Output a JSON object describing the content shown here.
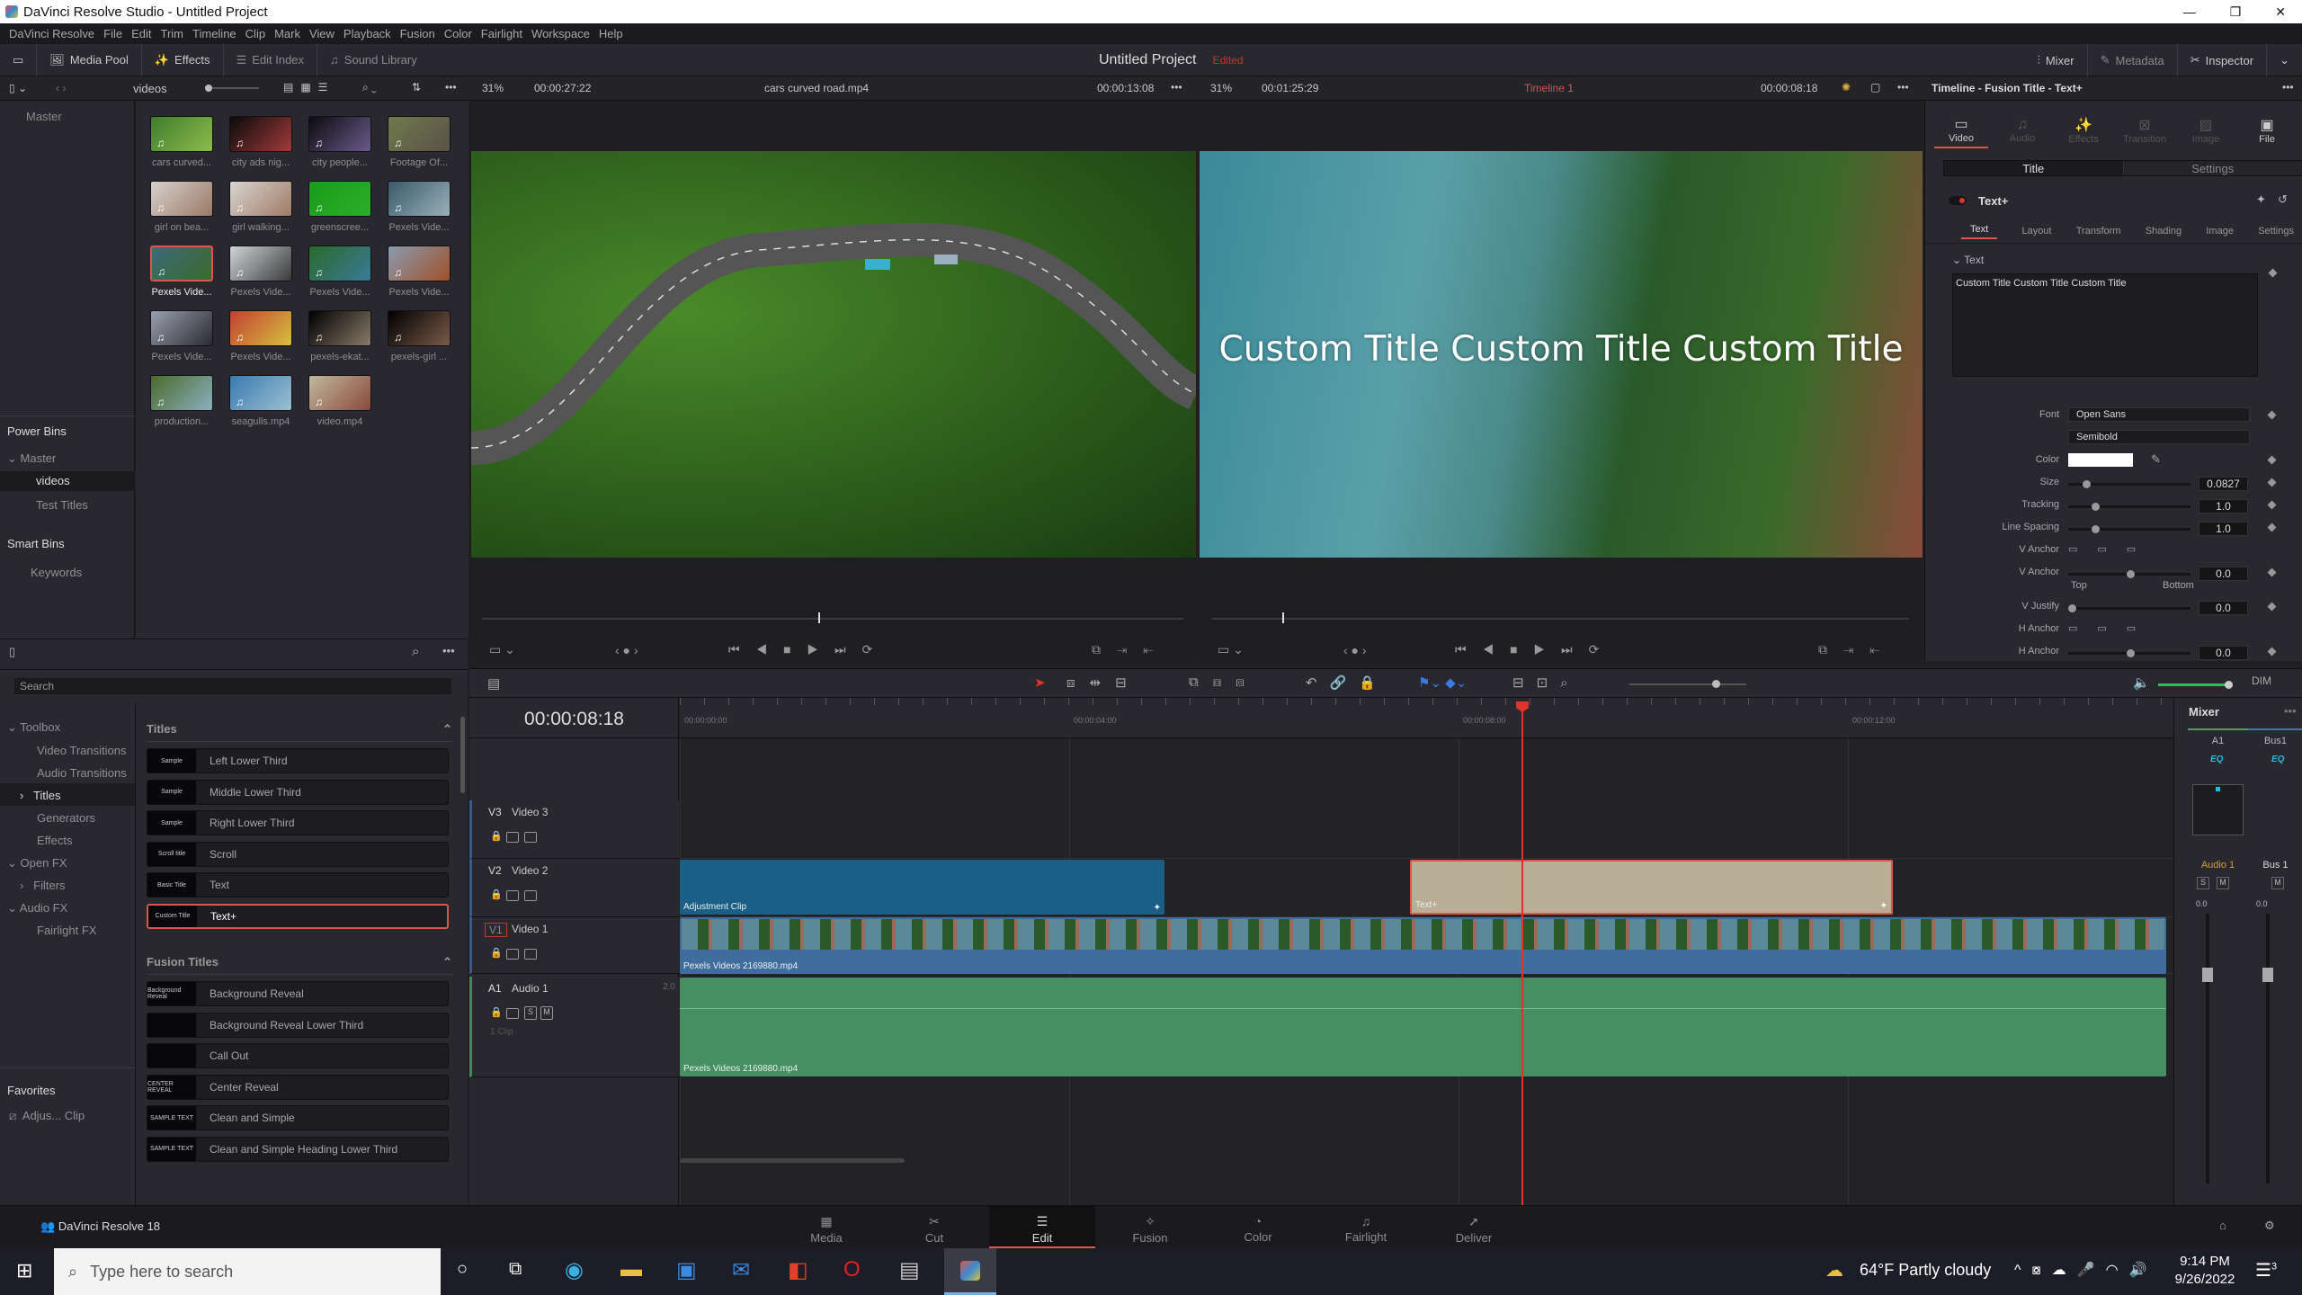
{
  "window": {
    "title": "DaVinci Resolve Studio - Untitled Project",
    "controls": [
      "—",
      "❐",
      "✕"
    ]
  },
  "menu": [
    "DaVinci Resolve",
    "File",
    "Edit",
    "Trim",
    "Timeline",
    "Clip",
    "Mark",
    "View",
    "Playback",
    "Fusion",
    "Color",
    "Fairlight",
    "Workspace",
    "Help"
  ],
  "toolbar": {
    "media_pool": "Media Pool",
    "effects": "Effects",
    "edit_index": "Edit Index",
    "sound_library": "Sound Library",
    "project_title": "Untitled Project",
    "project_status": "Edited",
    "mixer": "Mixer",
    "metadata": "Metadata",
    "inspector": "Inspector"
  },
  "source_bar": {
    "bin": "videos",
    "zoom": "31%",
    "duration": "00:00:27:22",
    "clip": "cars curved road.mp4",
    "timecode": "00:00:13:08"
  },
  "program_bar": {
    "zoom": "31%",
    "duration": "00:01:25:29",
    "timeline": "Timeline 1",
    "timecode": "00:00:08:18"
  },
  "bins": {
    "master": "Master",
    "power_bins": "Power Bins",
    "power_master": "Master",
    "items": [
      "videos",
      "Test Titles"
    ],
    "smart_bins": "Smart Bins",
    "keywords": "Keywords"
  },
  "media": [
    {
      "label": "cars curved...",
      "c1": "#3f7d2c",
      "c2": "#8dbb4c"
    },
    {
      "label": "city ads nig...",
      "c1": "#0a0a0a",
      "c2": "#a23a3a"
    },
    {
      "label": "city people...",
      "c1": "#0c0c10",
      "c2": "#6a5a8a"
    },
    {
      "label": "Footage Of...",
      "c1": "#6f7a4a",
      "c2": "#5a514a"
    },
    {
      "label": "girl on bea...",
      "c1": "#d8d0cc",
      "c2": "#9a7a66"
    },
    {
      "label": "girl walking...",
      "c1": "#d8d4d0",
      "c2": "#a07a66"
    },
    {
      "label": "greenscree...",
      "c1": "#1a9a1a",
      "c2": "#2bb02b"
    },
    {
      "label": "Pexels Vide...",
      "c1": "#3a5a6a",
      "c2": "#9ab0b8"
    },
    {
      "label": "Pexels Vide...",
      "c1": "#3a6a7a",
      "c2": "#3d6a2a",
      "selected": true
    },
    {
      "label": "Pexels Vide...",
      "c1": "#d0d4d8",
      "c2": "#3a3a3a"
    },
    {
      "label": "Pexels Vide...",
      "c1": "#2a6a2a",
      "c2": "#3a7a9a"
    },
    {
      "label": "Pexels Vide...",
      "c1": "#8a9ab0",
      "c2": "#a0502a"
    },
    {
      "label": "Pexels Vide...",
      "c1": "#9aa0b0",
      "c2": "#2a2a30"
    },
    {
      "label": "Pexels Vide...",
      "c1": "#c04030",
      "c2": "#d8c040"
    },
    {
      "label": "pexels-ekat...",
      "c1": "#000000",
      "c2": "#8a7a6a"
    },
    {
      "label": "pexels-girl ...",
      "c1": "#000000",
      "c2": "#7a5a4a"
    },
    {
      "label": "production...",
      "c1": "#4a6a2a",
      "c2": "#8ab0c0"
    },
    {
      "label": "seagulls.mp4",
      "c1": "#3a7ab0",
      "c2": "#9ac0d0"
    },
    {
      "label": "video.mp4",
      "c1": "#c0b8a0",
      "c2": "#8a4a3a"
    }
  ],
  "viewer": {
    "title_overlay": "Custom Title Custom Title Custom Title",
    "source_progress": 0.48,
    "program_progress": 0.1
  },
  "effects": {
    "toolbox": "Toolbox",
    "tree": [
      "Video Transitions",
      "Audio Transitions",
      "Titles",
      "Generators",
      "Effects"
    ],
    "open_fx": "Open FX",
    "filters": "Filters",
    "audio_fx": "Audio FX",
    "fairlight_fx": "Fairlight FX",
    "search": "Search",
    "favorites": "Favorites",
    "favorite_item": "Adjus... Clip",
    "titles_header": "Titles",
    "titles": [
      {
        "preview": "Sample",
        "name": "Left Lower Third"
      },
      {
        "preview": "Sample",
        "name": "Middle Lower Third"
      },
      {
        "preview": "Sample",
        "name": "Right Lower Third"
      },
      {
        "preview": "Scroll title",
        "name": "Scroll"
      },
      {
        "preview": "Basic Title",
        "name": "Text"
      },
      {
        "preview": "Custom Title",
        "name": "Text+",
        "selected": true
      }
    ],
    "fusion_header": "Fusion Titles",
    "fusion": [
      {
        "preview": "Background Reveal",
        "name": "Background Reveal"
      },
      {
        "preview": "",
        "name": "Background Reveal Lower Third"
      },
      {
        "preview": "",
        "name": "Call Out"
      },
      {
        "preview": "CENTER REVEAL",
        "name": "Center Reveal"
      },
      {
        "preview": "SAMPLE TEXT",
        "name": "Clean and Simple"
      },
      {
        "preview": "SAMPLE TEXT",
        "name": "Clean and Simple Heading Lower Third"
      }
    ]
  },
  "inspector": {
    "header": "Timeline - Fusion Title - Text+",
    "tabs": [
      "Video",
      "Audio",
      "Effects",
      "Transition",
      "Image",
      "File"
    ],
    "sub_tabs": [
      "Title",
      "Settings"
    ],
    "node": "Text+",
    "node_tabs": [
      "Text",
      "Layout",
      "Transform",
      "Shading",
      "Image",
      "Settings"
    ],
    "section": "Text",
    "text_value": "Custom Title Custom Title Custom Title",
    "font_label": "Font",
    "font": "Open Sans",
    "style": "Semibold",
    "color_label": "Color",
    "color": "#ffffff",
    "params": [
      {
        "label": "Size",
        "value": "0.0827",
        "pos": 0.12
      },
      {
        "label": "Tracking",
        "value": "1.0",
        "pos": 0.2
      },
      {
        "label": "Line Spacing",
        "value": "1.0",
        "pos": 0.2
      }
    ],
    "v_anchor_label": "V Anchor",
    "v_anchor": {
      "label": "V Anchor",
      "value": "0.0",
      "pos": 0.5,
      "left": "Top",
      "right": "Bottom"
    },
    "v_justify": {
      "label": "V Justify",
      "value": "0.0",
      "pos": 0.0
    },
    "h_anchor_label": "H Anchor",
    "h_anchor": {
      "label": "H Anchor",
      "value": "0.0",
      "pos": 0.5
    }
  },
  "timeline": {
    "timecode": "00:00:08:18",
    "ruler": [
      "00:00:00:00",
      "00:00:04:00",
      "00:00:08:00",
      "00:00:12:00"
    ],
    "tracks": [
      {
        "id": "V3",
        "name": "Video 3"
      },
      {
        "id": "V2",
        "name": "Video 2"
      },
      {
        "id": "V1",
        "name": "Video 1"
      }
    ],
    "audio": {
      "id": "A1",
      "name": "Audio 1",
      "channels": "2.0",
      "clips": "1 Clip",
      "solo": "S",
      "mute": "M"
    },
    "clips": {
      "adjustment": "Adjustment Clip",
      "title": "Text+",
      "video": "Pexels Videos 2169880.mp4",
      "audio": "Pexels Videos 2169880.mp4"
    }
  },
  "mixer": {
    "title": "Mixer",
    "channels": [
      "A1",
      "Bus1"
    ],
    "eq": "EQ",
    "names": [
      "Audio 1",
      "Bus 1"
    ],
    "levels": [
      "0.0",
      "0.0"
    ],
    "solo": "S",
    "mute": "M"
  },
  "pages": [
    {
      "icon": "▦",
      "label": "Media"
    },
    {
      "icon": "✂",
      "label": "Cut"
    },
    {
      "icon": "☰",
      "label": "Edit",
      "active": true
    },
    {
      "icon": "✧",
      "label": "Fusion"
    },
    {
      "icon": "◔",
      "label": "Color"
    },
    {
      "icon": "♫",
      "label": "Fairlight"
    },
    {
      "icon": "➚",
      "label": "Deliver"
    }
  ],
  "app_footer": "DaVinci Resolve 18",
  "taskbar": {
    "search": "Type here to search",
    "weather": "64°F  Partly cloudy",
    "time": "9:14 PM",
    "date": "9/26/2022",
    "notifications": "3"
  },
  "colors": {
    "accent": "#e64b3c",
    "adjustment_clip": "#1a5f85",
    "video_clip": "#3f6e9e",
    "audio_clip": "#468f63",
    "title_clip": "#b8ae96",
    "eq": "#2ab8e0"
  }
}
